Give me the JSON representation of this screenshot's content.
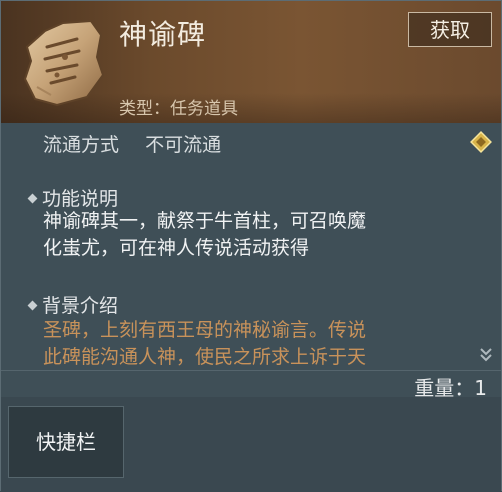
{
  "item": {
    "title": "神谕碑",
    "type_label": "类型：任务道具",
    "icon": "stone-tablet-icon"
  },
  "header": {
    "acquire_label": "获取"
  },
  "circulation": {
    "label": "流通方式",
    "value": "不可流通"
  },
  "function": {
    "heading": "功能说明",
    "lines": [
      "神谕碑其一，献祭于牛首柱，可召唤魔",
      "化蚩尤，可在神人传说活动获得"
    ]
  },
  "background": {
    "heading": "背景介绍",
    "lines": [
      "圣碑，上刻有西王母的神秘谕言。传说",
      "此碑能沟通人神，使民之所求上诉于天"
    ]
  },
  "weight": "重量：1",
  "hotbar_label": "快捷栏",
  "colors": {
    "lore_text": "#c8925a",
    "header_brown": "#6b4a2c",
    "panel_bg": "#3f4f57"
  }
}
